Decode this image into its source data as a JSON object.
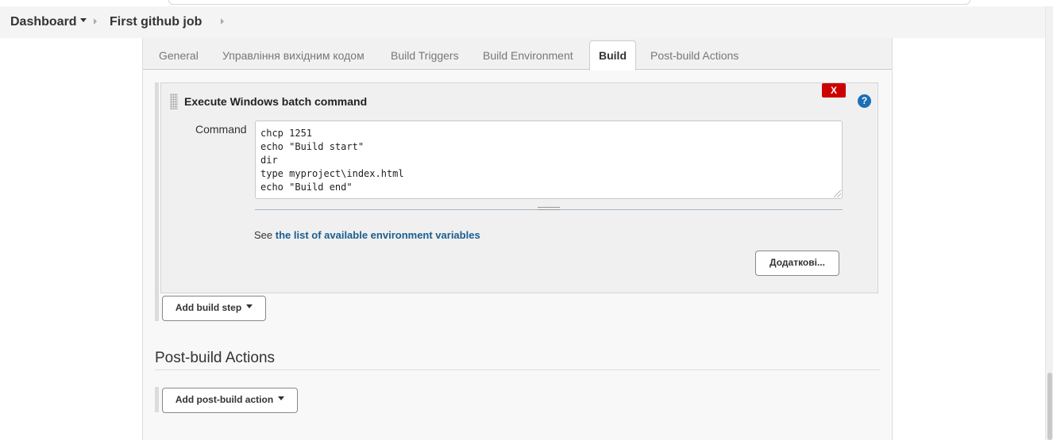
{
  "breadcrumb": {
    "dashboard": "Dashboard",
    "job": "First github job"
  },
  "tabs": [
    "General",
    "Управління вихідним кодом",
    "Build Triggers",
    "Build Environment",
    "Build",
    "Post-build Actions"
  ],
  "active_tab": "Build",
  "build_step": {
    "title": "Execute Windows batch command",
    "delete_label": "X",
    "help_label": "?",
    "command_label": "Command",
    "command_value": "chcp 1251\necho \"Build start\"\ndir\ntype myproject\\index.html\necho \"Build end\"",
    "see_text": "See ",
    "env_link": "the list of available environment variables",
    "advanced_button": "Додаткові..."
  },
  "add_build_step": "Add build step",
  "post_build": {
    "title": "Post-build Actions",
    "add_action": "Add post-build action"
  }
}
